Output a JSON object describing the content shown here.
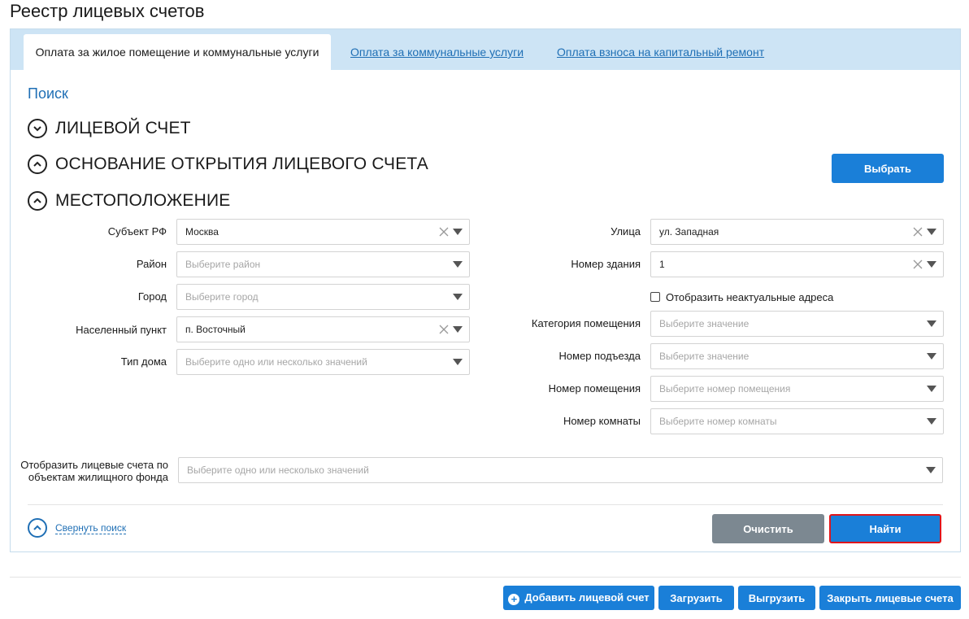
{
  "page": {
    "title": "Реестр лицевых счетов"
  },
  "tabs": [
    {
      "label": "Оплата за жилое помещение и коммунальные услуги",
      "active": true
    },
    {
      "label": "Оплата за коммунальные услуги",
      "active": false
    },
    {
      "label": "Оплата взноса на капитальный ремонт",
      "active": false
    }
  ],
  "search": {
    "title": "Поиск",
    "sections": {
      "account": "ЛИЦЕВОЙ СЧЕТ",
      "basis": "ОСНОВАНИЕ ОТКРЫТИЯ ЛИЦЕВОГО СЧЕТА",
      "location": "МЕСТОПОЛОЖЕНИЕ"
    },
    "select_button": "Выбрать",
    "fields": {
      "subject": {
        "label": "Субъект РФ",
        "value": "Москва",
        "placeholder": ""
      },
      "district": {
        "label": "Район",
        "value": "",
        "placeholder": "Выберите район"
      },
      "city": {
        "label": "Город",
        "value": "",
        "placeholder": "Выберите город"
      },
      "settlement": {
        "label": "Населенный пункт",
        "value": "п. Восточный",
        "placeholder": ""
      },
      "house_type": {
        "label": "Тип дома",
        "value": "",
        "placeholder": "Выберите одно или несколько значений"
      },
      "street": {
        "label": "Улица",
        "value": "ул. Западная",
        "placeholder": ""
      },
      "building": {
        "label": "Номер здания",
        "value": "1",
        "placeholder": ""
      },
      "show_inactive": {
        "label": "Отобразить неактуальные адреса",
        "checked": false
      },
      "premises_category": {
        "label": "Категория помещения",
        "value": "",
        "placeholder": "Выберите значение"
      },
      "entrance": {
        "label": "Номер подъезда",
        "value": "",
        "placeholder": "Выберите значение"
      },
      "premises_number": {
        "label": "Номер помещения",
        "value": "",
        "placeholder": "Выберите номер помещения"
      },
      "room_number": {
        "label": "Номер комнаты",
        "value": "",
        "placeholder": "Выберите номер комнаты"
      },
      "housing_objects": {
        "label_line1": "Отобразить лицевые счета по",
        "label_line2": "объектам жилищного фонда",
        "value": "",
        "placeholder": "Выберите одно или несколько значений"
      }
    },
    "collapse_label": "Свернуть поиск",
    "clear_button": "Очистить",
    "find_button": "Найти"
  },
  "bottom_actions": {
    "add": "Добавить лицевой счет",
    "upload": "Загрузить",
    "download": "Выгрузить",
    "close_accounts": "Закрыть лицевые счета"
  },
  "colors": {
    "accent": "#1a7fd8",
    "link": "#1f6fb5",
    "tabbar": "#cde4f5",
    "highlight_border": "#e0151b",
    "gray_button": "#7c8891"
  },
  "icons": {
    "section_expanded": "chevron-up-circle-icon",
    "section_collapsed": "chevron-down-circle-icon",
    "clear": "close-icon",
    "dropdown": "caret-down-icon",
    "add": "plus-circle-icon"
  }
}
